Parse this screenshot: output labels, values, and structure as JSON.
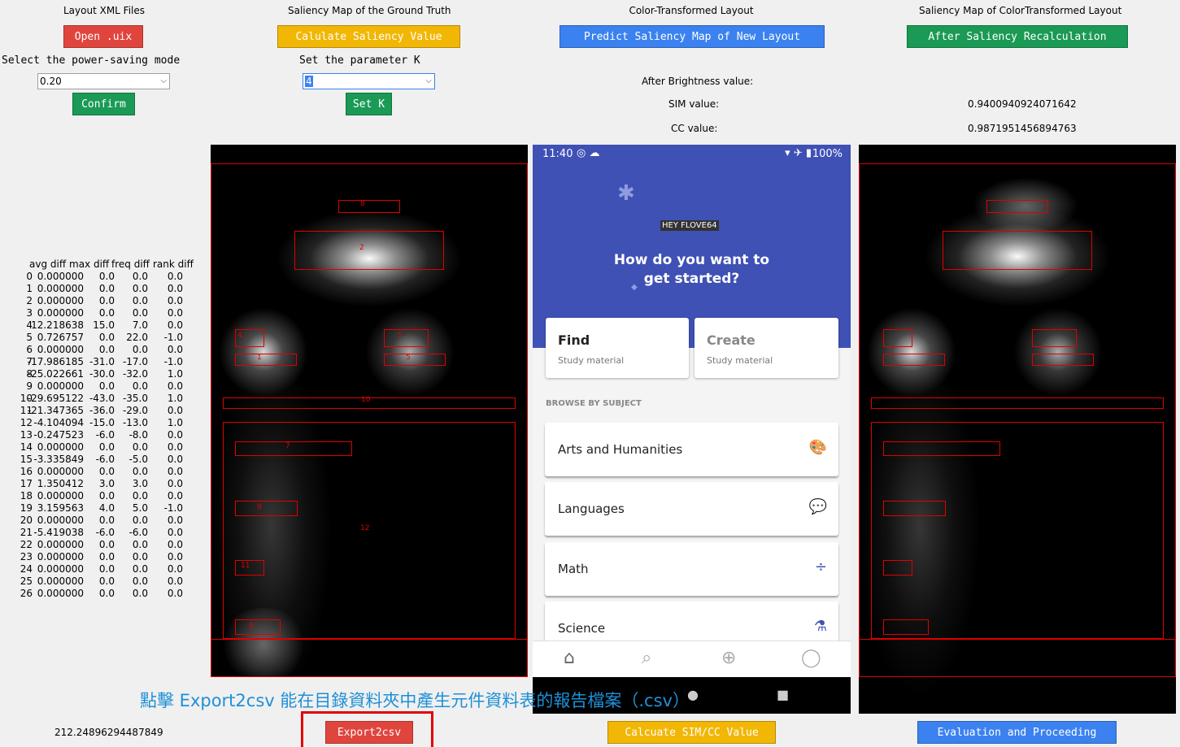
{
  "columns": {
    "c1": {
      "title": "Layout XML Files",
      "button": "Open .uix",
      "select_label": "Select the power-saving mode",
      "select_value": "0.20",
      "confirm": "Confirm"
    },
    "c2": {
      "title": "Saliency Map of the Ground Truth",
      "button": "Calulate Saliency Value",
      "select_label": "Set the parameter K",
      "select_value": "4",
      "setk": "Set K"
    },
    "c3": {
      "title": "Color-Transformed Layout",
      "button": "Predict Saliency Map of New Layout",
      "brightness_label": "After Brightness value:",
      "sim_label": "SIM value:",
      "cc_label": "CC value:"
    },
    "c4": {
      "title": "Saliency Map of ColorTransformed Layout",
      "button": "After Saliency Recalculation",
      "sim_value": "0.9400940924071642",
      "cc_value": "0.9871951456894763"
    }
  },
  "table": {
    "headers": [
      "avg diff",
      "max diff",
      "freq diff",
      "rank diff"
    ],
    "rows": [
      [
        "0",
        "0.000000",
        "0.0",
        "0.0",
        "0.0"
      ],
      [
        "1",
        "0.000000",
        "0.0",
        "0.0",
        "0.0"
      ],
      [
        "2",
        "0.000000",
        "0.0",
        "0.0",
        "0.0"
      ],
      [
        "3",
        "0.000000",
        "0.0",
        "0.0",
        "0.0"
      ],
      [
        "4",
        "12.218638",
        "15.0",
        "7.0",
        "0.0"
      ],
      [
        "5",
        "0.726757",
        "0.0",
        "22.0",
        "-1.0"
      ],
      [
        "6",
        "0.000000",
        "0.0",
        "0.0",
        "0.0"
      ],
      [
        "7",
        "-17.986185",
        "-31.0",
        "-17.0",
        "-1.0"
      ],
      [
        "8",
        "-25.022661",
        "-30.0",
        "-32.0",
        "1.0"
      ],
      [
        "9",
        "0.000000",
        "0.0",
        "0.0",
        "0.0"
      ],
      [
        "10",
        "-29.695122",
        "-43.0",
        "-35.0",
        "1.0"
      ],
      [
        "11",
        "-21.347365",
        "-36.0",
        "-29.0",
        "0.0"
      ],
      [
        "12",
        "-4.104094",
        "-15.0",
        "-13.0",
        "1.0"
      ],
      [
        "13",
        "-0.247523",
        "-6.0",
        "-8.0",
        "0.0"
      ],
      [
        "14",
        "0.000000",
        "0.0",
        "0.0",
        "0.0"
      ],
      [
        "15",
        "-3.335849",
        "-6.0",
        "-5.0",
        "0.0"
      ],
      [
        "16",
        "0.000000",
        "0.0",
        "0.0",
        "0.0"
      ],
      [
        "17",
        "1.350412",
        "3.0",
        "3.0",
        "0.0"
      ],
      [
        "18",
        "0.000000",
        "0.0",
        "0.0",
        "0.0"
      ],
      [
        "19",
        "3.159563",
        "4.0",
        "5.0",
        "-1.0"
      ],
      [
        "20",
        "0.000000",
        "0.0",
        "0.0",
        "0.0"
      ],
      [
        "21",
        "-5.419038",
        "-6.0",
        "-6.0",
        "0.0"
      ],
      [
        "22",
        "0.000000",
        "0.0",
        "0.0",
        "0.0"
      ],
      [
        "23",
        "0.000000",
        "0.0",
        "0.0",
        "0.0"
      ],
      [
        "24",
        "0.000000",
        "0.0",
        "0.0",
        "0.0"
      ],
      [
        "25",
        "0.000000",
        "0.0",
        "0.0",
        "0.0"
      ],
      [
        "26",
        "0.000000",
        "0.0",
        "0.0",
        "0.0"
      ]
    ]
  },
  "bottom": {
    "value": "212.24896294487849",
    "export": "Export2csv",
    "calc": "Calcuate SIM/CC Value",
    "eval": "Evaluation and Proceeding",
    "annotation": "點擊 Export2csv 能在目錄資料夾中產生元件資料表的報告檔案（.csv）"
  },
  "box_labels": [
    "8",
    "2",
    "4",
    "3",
    "1",
    "5",
    "10",
    "7",
    "9",
    "12",
    "11",
    "6"
  ],
  "phone": {
    "time": "11:40",
    "battery": "100%",
    "greeting": "HEY FLOVE64",
    "question_line1": "How do you want to",
    "question_line2": "get started?",
    "find_title": "Find",
    "find_sub": "Study material",
    "create_title": "Create",
    "create_sub": "Study material",
    "browse": "BROWSE BY SUBJECT",
    "subjects": [
      "Arts and Humanities",
      "Languages",
      "Math",
      "Science"
    ]
  },
  "colors": {
    "accent": "#3f51b5",
    "red_btn": "#e0453d",
    "yellow_btn": "#f2b705",
    "blue_btn": "#3b82f0",
    "green_btn": "#1a9a55",
    "annotation": "#1e90d6"
  }
}
